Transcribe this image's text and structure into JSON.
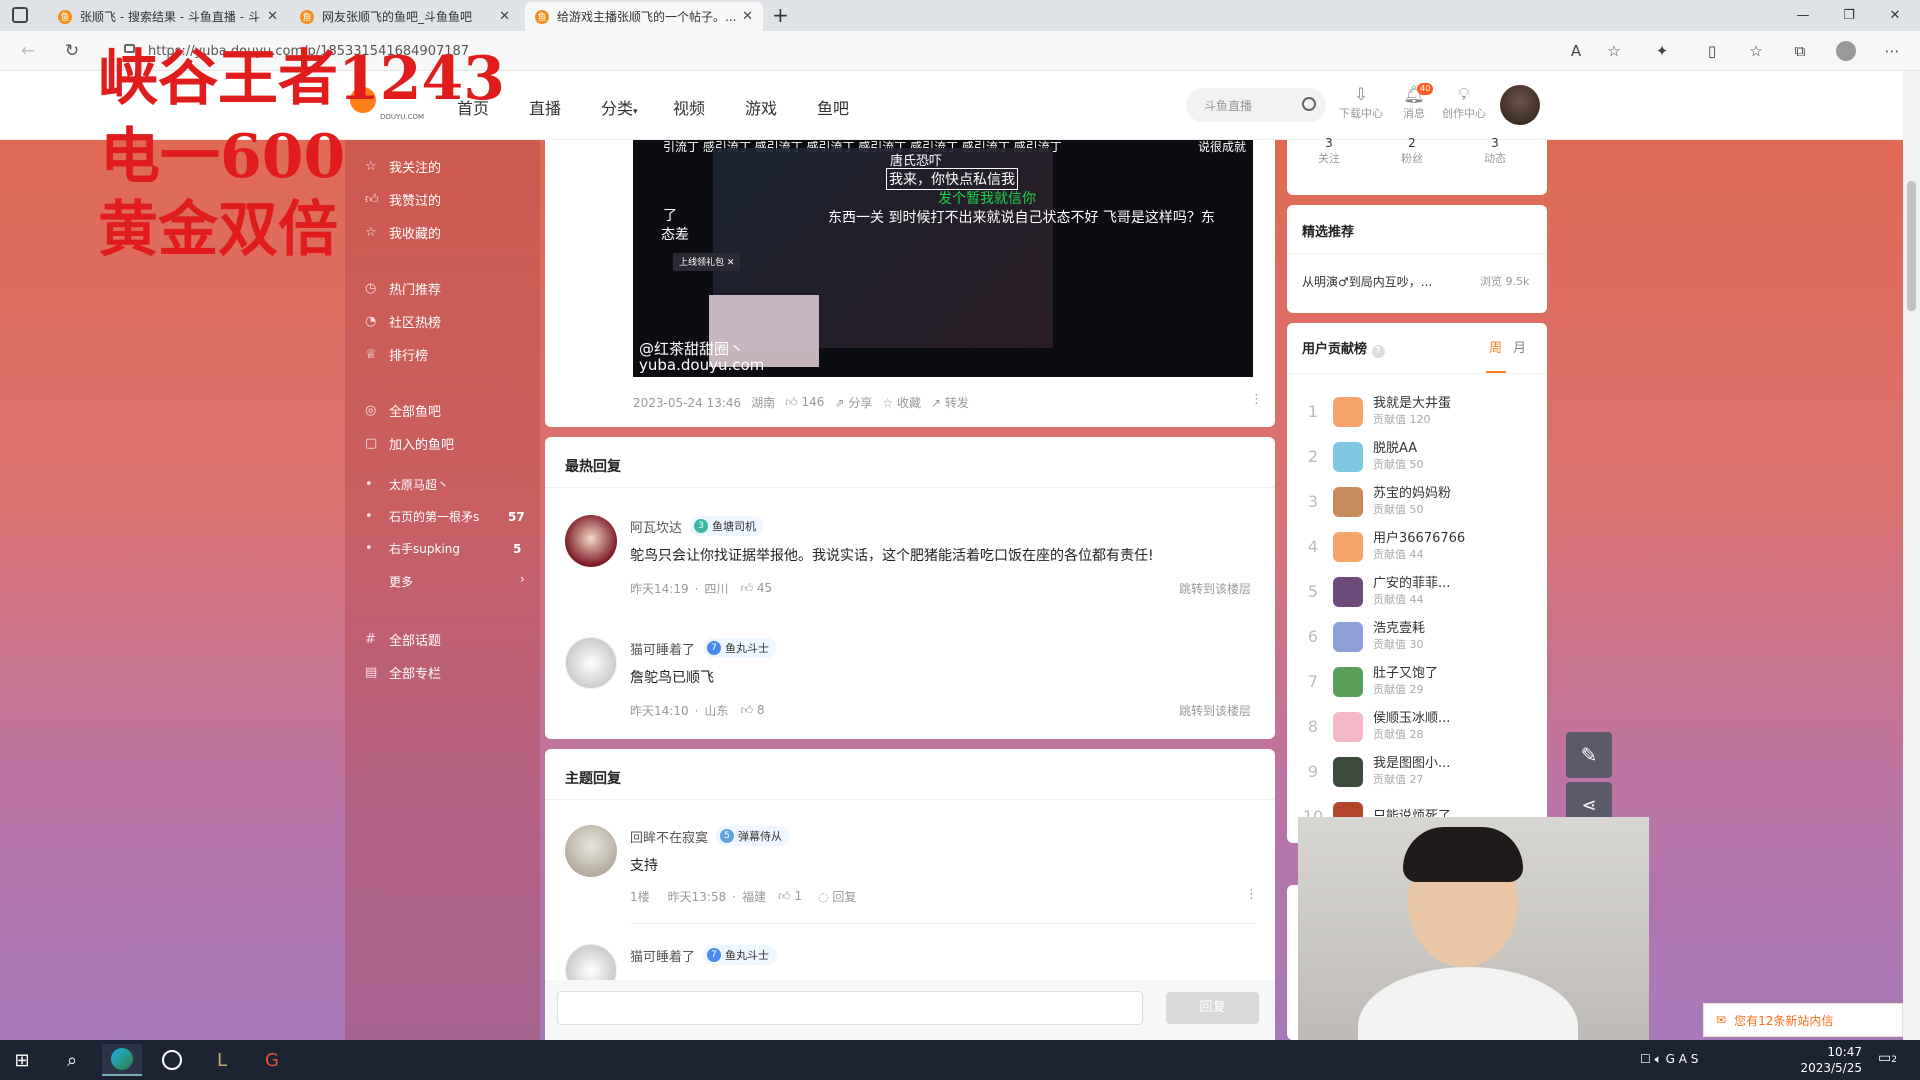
{
  "browser": {
    "tabs": [
      {
        "title": "张顺飞 - 搜索结果 - 斗鱼直播 - 斗"
      },
      {
        "title": "网友张顺飞的鱼吧_斗鱼鱼吧"
      },
      {
        "title": "给游戏主播张顺飞的一个帖子。..."
      }
    ],
    "url": "https://yuba.douyu.com/p/185331541684907187"
  },
  "site": {
    "logo_text": "DOUYU.COM",
    "nav": [
      "首页",
      "直播",
      "分类",
      "视频",
      "游戏",
      "鱼吧"
    ],
    "search_placeholder": "斗鱼直播",
    "header_icons": [
      {
        "label": "下载中心",
        "icon": "download-icon"
      },
      {
        "label": "消息",
        "icon": "bell-icon",
        "badge": "40"
      },
      {
        "label": "创作中心",
        "icon": "bulb-icon"
      }
    ]
  },
  "overlay": {
    "lines": [
      "峡谷王者1243",
      "电一600",
      "黄金双倍"
    ]
  },
  "left_nav": {
    "group1": [
      "我关注的",
      "我赞过的",
      "我收藏的"
    ],
    "group2": [
      "热门推荐",
      "社区热榜",
      "排行榜"
    ],
    "group3": [
      "全部鱼吧",
      "加入的鱼吧"
    ],
    "bars": [
      {
        "name": "太原马超丶",
        "count": ""
      },
      {
        "name": "石页的第一根矛s",
        "count": "57"
      },
      {
        "name": "右手supking",
        "count": "5"
      }
    ],
    "more": "更多",
    "group4": [
      "全部话题",
      "全部专栏"
    ]
  },
  "post": {
    "video_captions": {
      "top": "引流丁 感引流丁 感引流丁 感引流丁 感引流丁 感引流丁 感引流丁 感引流丁",
      "l1": "唐氏恐吓",
      "l2": "我来，你快点私信我",
      "l3": "发个暂我就信你",
      "l4": "东西一关 到时候打不出来就说自己状态不好 飞哥是这样吗？东",
      "left1": "了",
      "left2": "态差",
      "right1": "说很成就",
      "gift": "上线领礼包",
      "watermark1": "@红茶甜甜圈丶",
      "watermark2": "yuba.douyu.com"
    },
    "date": "2023-05-24 13:46",
    "location": "湖南",
    "likes": "146",
    "share": "分享",
    "collect": "收藏",
    "forward": "转发"
  },
  "hot_replies": {
    "title": "最热回复",
    "items": [
      {
        "name": "阿瓦坎达",
        "badge_level": "3",
        "badge": "鱼塘司机",
        "text": "鸵鸟只会让你找证据举报他。我说实话，这个肥猪能活着吃口饭在座的各位都有责任!",
        "time": "昨天14:19",
        "location": "四川",
        "likes": "45",
        "jump": "跳转到该楼层"
      },
      {
        "name": "猫可睡着了",
        "badge_level": "7",
        "badge": "鱼丸斗士",
        "text": "詹鸵鸟已顺飞",
        "time": "昨天14:10",
        "location": "山东",
        "likes": "8",
        "jump": "跳转到该楼层"
      }
    ]
  },
  "topic_replies": {
    "title": "主题回复",
    "items": [
      {
        "name": "回眸不在寂寞",
        "badge_level": "5",
        "badge": "弹幕侍从",
        "text": "支持",
        "floor": "1楼",
        "time": "昨天13:58",
        "location": "福建",
        "likes": "1",
        "reply": "回复"
      },
      {
        "name": "猫可睡着了",
        "badge_level": "7",
        "badge": "鱼丸斗士"
      }
    ],
    "reply_button": "回复"
  },
  "right_sidebar": {
    "stats": [
      {
        "value": "3",
        "label": "关注"
      },
      {
        "value": "2",
        "label": "粉丝"
      },
      {
        "value": "3",
        "label": "动态"
      }
    ],
    "featured_title": "精选推荐",
    "featured_item": "从明演♂到局内互吵，...",
    "featured_views": "浏览 9.5k",
    "rank_title": "用户贡献榜",
    "rank_tabs": [
      "周",
      "月"
    ],
    "rank_value_label": "贡献值",
    "ranking": [
      {
        "rank": "1",
        "name": "我就是大井蛋",
        "value": "120",
        "color": "#f5a46b"
      },
      {
        "rank": "2",
        "name": "脱脱AA",
        "value": "50",
        "color": "#7ec8e3"
      },
      {
        "rank": "3",
        "name": "苏宝的妈妈粉",
        "value": "50",
        "color": "#c98a5e"
      },
      {
        "rank": "4",
        "name": "用户36676766",
        "value": "44",
        "color": "#f5a46b"
      },
      {
        "rank": "5",
        "name": "广安的菲菲...",
        "value": "44",
        "color": "#6d4b7a"
      },
      {
        "rank": "6",
        "name": "浩克壹耗",
        "value": "30",
        "color": "#8da0d8"
      },
      {
        "rank": "7",
        "name": "肚子又饱了",
        "value": "29",
        "color": "#5aa05a"
      },
      {
        "rank": "8",
        "name": "侯顺玉冰顺...",
        "value": "28",
        "color": "#f2b8c6"
      },
      {
        "rank": "9",
        "name": "我是图图小...",
        "value": "27",
        "color": "#3b4a3a"
      },
      {
        "rank": "10",
        "name": "只能说烦死了",
        "value": "",
        "color": "#b5442c"
      }
    ]
  },
  "notification": {
    "text": "您有12条新站内信"
  },
  "taskbar": {
    "time": "10:47",
    "date": "2023/5/25",
    "notif_count": "2"
  }
}
